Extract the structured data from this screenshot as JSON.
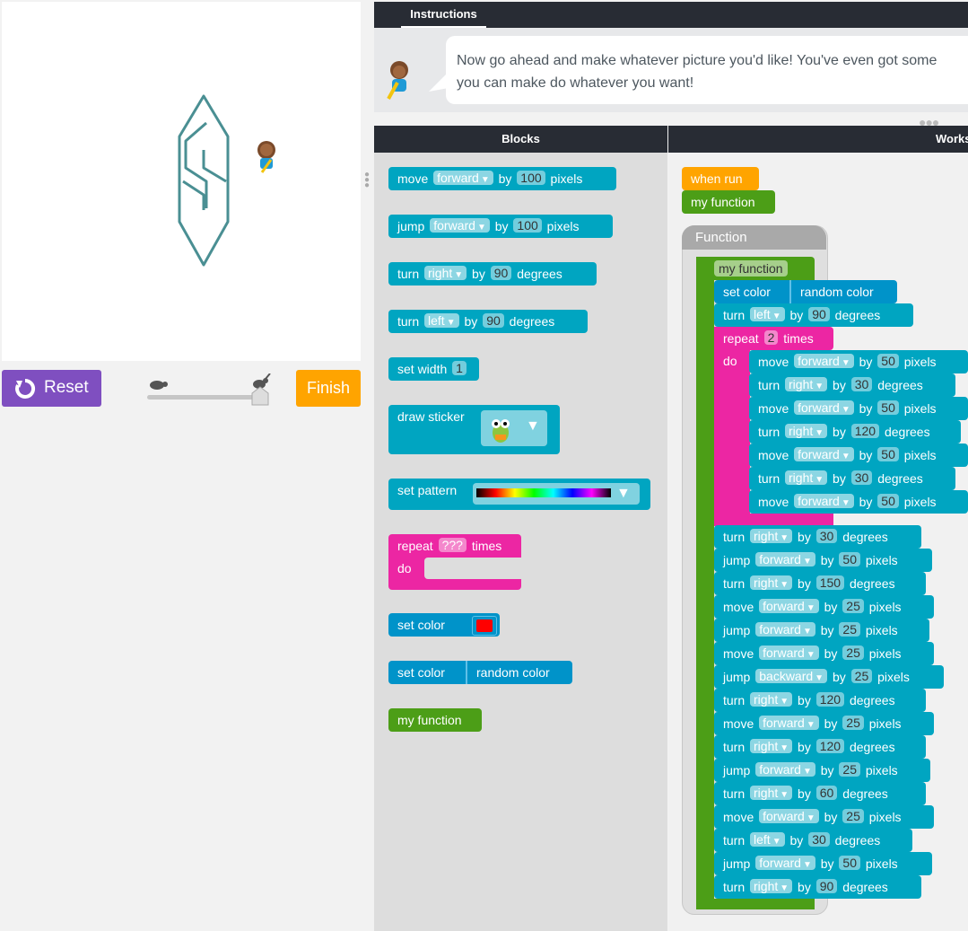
{
  "instructions": {
    "tab_label": "Instructions",
    "text_line1": "Now go ahead and make whatever picture you'd like! You've even got some",
    "text_line2": "you can make do whatever you want!"
  },
  "controls": {
    "reset_label": "Reset",
    "finish_label": "Finish"
  },
  "headers": {
    "blocks": "Blocks",
    "workspace": "Works"
  },
  "toolbox": {
    "move": {
      "verb": "move",
      "dir": "forward",
      "by": "by",
      "val": "100",
      "unit": "pixels"
    },
    "jump": {
      "verb": "jump",
      "dir": "forward",
      "by": "by",
      "val": "100",
      "unit": "pixels"
    },
    "turn_right": {
      "verb": "turn",
      "dir": "right",
      "by": "by",
      "val": "90",
      "unit": "degrees"
    },
    "turn_left": {
      "verb": "turn",
      "dir": "left",
      "by": "by",
      "val": "90",
      "unit": "degrees"
    },
    "set_width": {
      "label": "set width",
      "val": "1"
    },
    "draw_sticker": {
      "label": "draw sticker"
    },
    "set_pattern": {
      "label": "set pattern"
    },
    "repeat": {
      "label": "repeat",
      "val": "???",
      "times": "times",
      "do": "do"
    },
    "set_color": {
      "label": "set color",
      "color": "#ff0000"
    },
    "set_color_random": {
      "label": "set color",
      "value": "random color"
    },
    "my_function": {
      "label": "my function"
    }
  },
  "workspace": {
    "when_run": "when run",
    "call_function": "my function",
    "function_frame_title": "Function",
    "function_name": "my function",
    "set_color": {
      "label": "set color",
      "value": "random color"
    },
    "turn_left": {
      "verb": "turn",
      "dir": "left",
      "by": "by",
      "val": "90",
      "unit": "degrees"
    },
    "repeat": {
      "label": "repeat",
      "val": "2",
      "times": "times",
      "do": "do"
    },
    "inner": [
      {
        "verb": "move",
        "dir": "forward",
        "by": "by",
        "val": "50",
        "unit": "pixels"
      },
      {
        "verb": "turn",
        "dir": "right",
        "by": "by",
        "val": "30",
        "unit": "degrees"
      },
      {
        "verb": "move",
        "dir": "forward",
        "by": "by",
        "val": "50",
        "unit": "pixels"
      },
      {
        "verb": "turn",
        "dir": "right",
        "by": "by",
        "val": "120",
        "unit": "degrees"
      },
      {
        "verb": "move",
        "dir": "forward",
        "by": "by",
        "val": "50",
        "unit": "pixels"
      },
      {
        "verb": "turn",
        "dir": "right",
        "by": "by",
        "val": "30",
        "unit": "degrees"
      },
      {
        "verb": "move",
        "dir": "forward",
        "by": "by",
        "val": "50",
        "unit": "pixels"
      }
    ],
    "after": [
      {
        "verb": "turn",
        "dir": "right",
        "by": "by",
        "val": "30",
        "unit": "degrees"
      },
      {
        "verb": "jump",
        "dir": "forward",
        "by": "by",
        "val": "50",
        "unit": "pixels"
      },
      {
        "verb": "turn",
        "dir": "right",
        "by": "by",
        "val": "150",
        "unit": "degrees"
      },
      {
        "verb": "move",
        "dir": "forward",
        "by": "by",
        "val": "25",
        "unit": "pixels"
      },
      {
        "verb": "jump",
        "dir": "forward",
        "by": "by",
        "val": "25",
        "unit": "pixels"
      },
      {
        "verb": "move",
        "dir": "forward",
        "by": "by",
        "val": "25",
        "unit": "pixels"
      },
      {
        "verb": "jump",
        "dir": "backward",
        "by": "by",
        "val": "25",
        "unit": "pixels"
      },
      {
        "verb": "turn",
        "dir": "right",
        "by": "by",
        "val": "120",
        "unit": "degrees"
      },
      {
        "verb": "move",
        "dir": "forward",
        "by": "by",
        "val": "25",
        "unit": "pixels"
      },
      {
        "verb": "turn",
        "dir": "right",
        "by": "by",
        "val": "120",
        "unit": "degrees"
      },
      {
        "verb": "jump",
        "dir": "forward",
        "by": "by",
        "val": "25",
        "unit": "pixels"
      },
      {
        "verb": "turn",
        "dir": "right",
        "by": "by",
        "val": "60",
        "unit": "degrees"
      },
      {
        "verb": "move",
        "dir": "forward",
        "by": "by",
        "val": "25",
        "unit": "pixels"
      },
      {
        "verb": "turn",
        "dir": "left",
        "by": "by",
        "val": "30",
        "unit": "degrees"
      },
      {
        "verb": "jump",
        "dir": "forward",
        "by": "by",
        "val": "50",
        "unit": "pixels"
      },
      {
        "verb": "turn",
        "dir": "right",
        "by": "by",
        "val": "90",
        "unit": "degrees"
      }
    ]
  },
  "colors": {
    "teal": "#00a5c1",
    "pink": "#ec26a3",
    "green": "#4c9e17",
    "orange": "#ffa400",
    "purple": "#7f4fc0",
    "drawing": "#4a8f93"
  }
}
